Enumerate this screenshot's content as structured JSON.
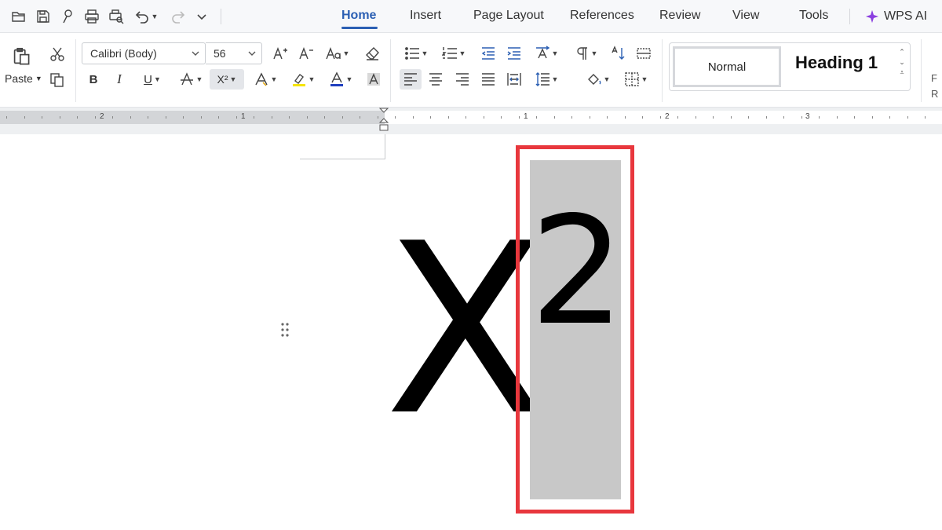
{
  "menu": {
    "tabs": [
      {
        "label": "Home",
        "active": true
      },
      {
        "label": "Insert"
      },
      {
        "label": "Page Layout"
      },
      {
        "label": "References"
      },
      {
        "label": "Review"
      },
      {
        "label": "View"
      },
      {
        "label": "Tools"
      }
    ],
    "wps_ai": "WPS AI",
    "quick_access_icons": [
      "open-folder-icon",
      "save-icon",
      "format-painter-icon",
      "print-icon",
      "print-preview-icon",
      "undo-icon",
      "redo-icon",
      "customize-icon"
    ]
  },
  "ribbon": {
    "paste_label": "Paste",
    "font_name": "Calibri (Body)",
    "font_size": "56",
    "superscript_label": "X²",
    "bold_label": "B",
    "italic_label": "I",
    "underline_label": "U",
    "styles": {
      "normal": "Normal",
      "heading1": "Heading 1"
    },
    "cut_off_text": [
      "F",
      "R"
    ],
    "colors": {
      "highlight": "#f5e400",
      "font_color": "#1f3fbf",
      "accent": "#2b5fb3"
    }
  },
  "ruler": {
    "labels": [
      "2",
      "1",
      "1",
      "2",
      "3"
    ]
  },
  "document": {
    "base_text": "X",
    "superscript_text": "2",
    "annotation_color": "#e8373d"
  }
}
